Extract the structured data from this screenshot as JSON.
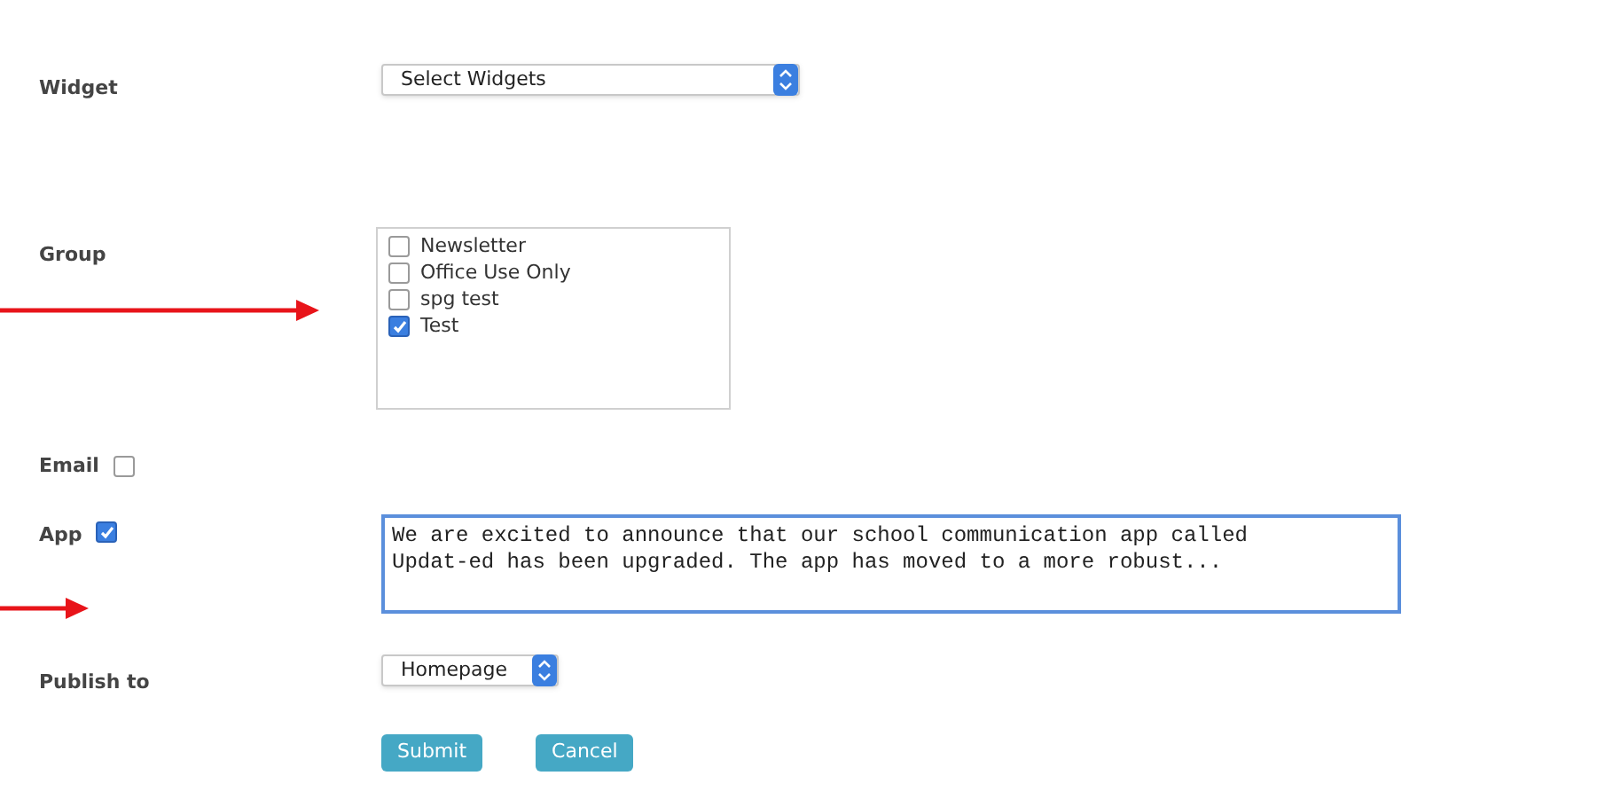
{
  "widget": {
    "label": "Widget",
    "select_value": "Select Widgets"
  },
  "group": {
    "label": "Group",
    "options": [
      {
        "label": "Newsletter",
        "checked": false
      },
      {
        "label": "Office Use Only",
        "checked": false
      },
      {
        "label": "spg test",
        "checked": false
      },
      {
        "label": "Test",
        "checked": true
      }
    ]
  },
  "email": {
    "label": "Email",
    "checked": false
  },
  "app": {
    "label": "App",
    "checked": true,
    "message": "We are excited to announce that our school communication app called Updat-ed has been upgraded. The app has moved to a more robust..."
  },
  "publish_to": {
    "label": "Publish to",
    "select_value": "Homepage"
  },
  "buttons": [
    "Submit",
    "Cancel"
  ]
}
